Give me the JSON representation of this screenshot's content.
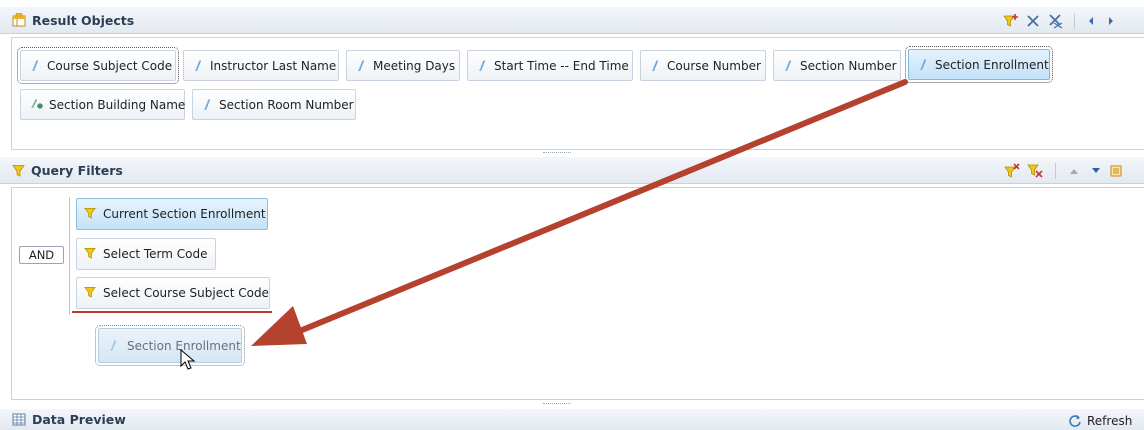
{
  "result_objects": {
    "title": "Result Objects",
    "chips": [
      {
        "label": "Course Subject Code"
      },
      {
        "label": "Instructor Last Name"
      },
      {
        "label": "Meeting Days"
      },
      {
        "label": "Start Time -- End Time"
      },
      {
        "label": "Course Number"
      },
      {
        "label": "Section Number"
      },
      {
        "label": "Section Enrollment"
      },
      {
        "label": "Section Building Name"
      },
      {
        "label": "Section Room Number"
      }
    ],
    "toolbar_icons": [
      "add-filter-icon",
      "remove-icon",
      "remove-all-icon",
      "previous-icon",
      "next-icon"
    ]
  },
  "query_filters": {
    "title": "Query Filters",
    "operator": "AND",
    "filters": [
      {
        "label": "Current Section Enrollment"
      },
      {
        "label": "Select Term Code"
      },
      {
        "label": "Select Course Subject Code"
      }
    ],
    "drag_ghost": {
      "label": "Section Enrollment"
    },
    "toolbar_icons": [
      "remove-filter-icon",
      "remove-all-filters-icon",
      "move-up-icon",
      "move-down-icon",
      "options-icon"
    ]
  },
  "data_preview": {
    "title": "Data Preview",
    "refresh_label": "Refresh"
  },
  "colors": {
    "arrow": "#b5422f",
    "selected_chip": "#c3e1f7",
    "drop_indicator": "#c0392b",
    "funnel": "#f2c618",
    "object_icon": "#5e9ad6"
  }
}
